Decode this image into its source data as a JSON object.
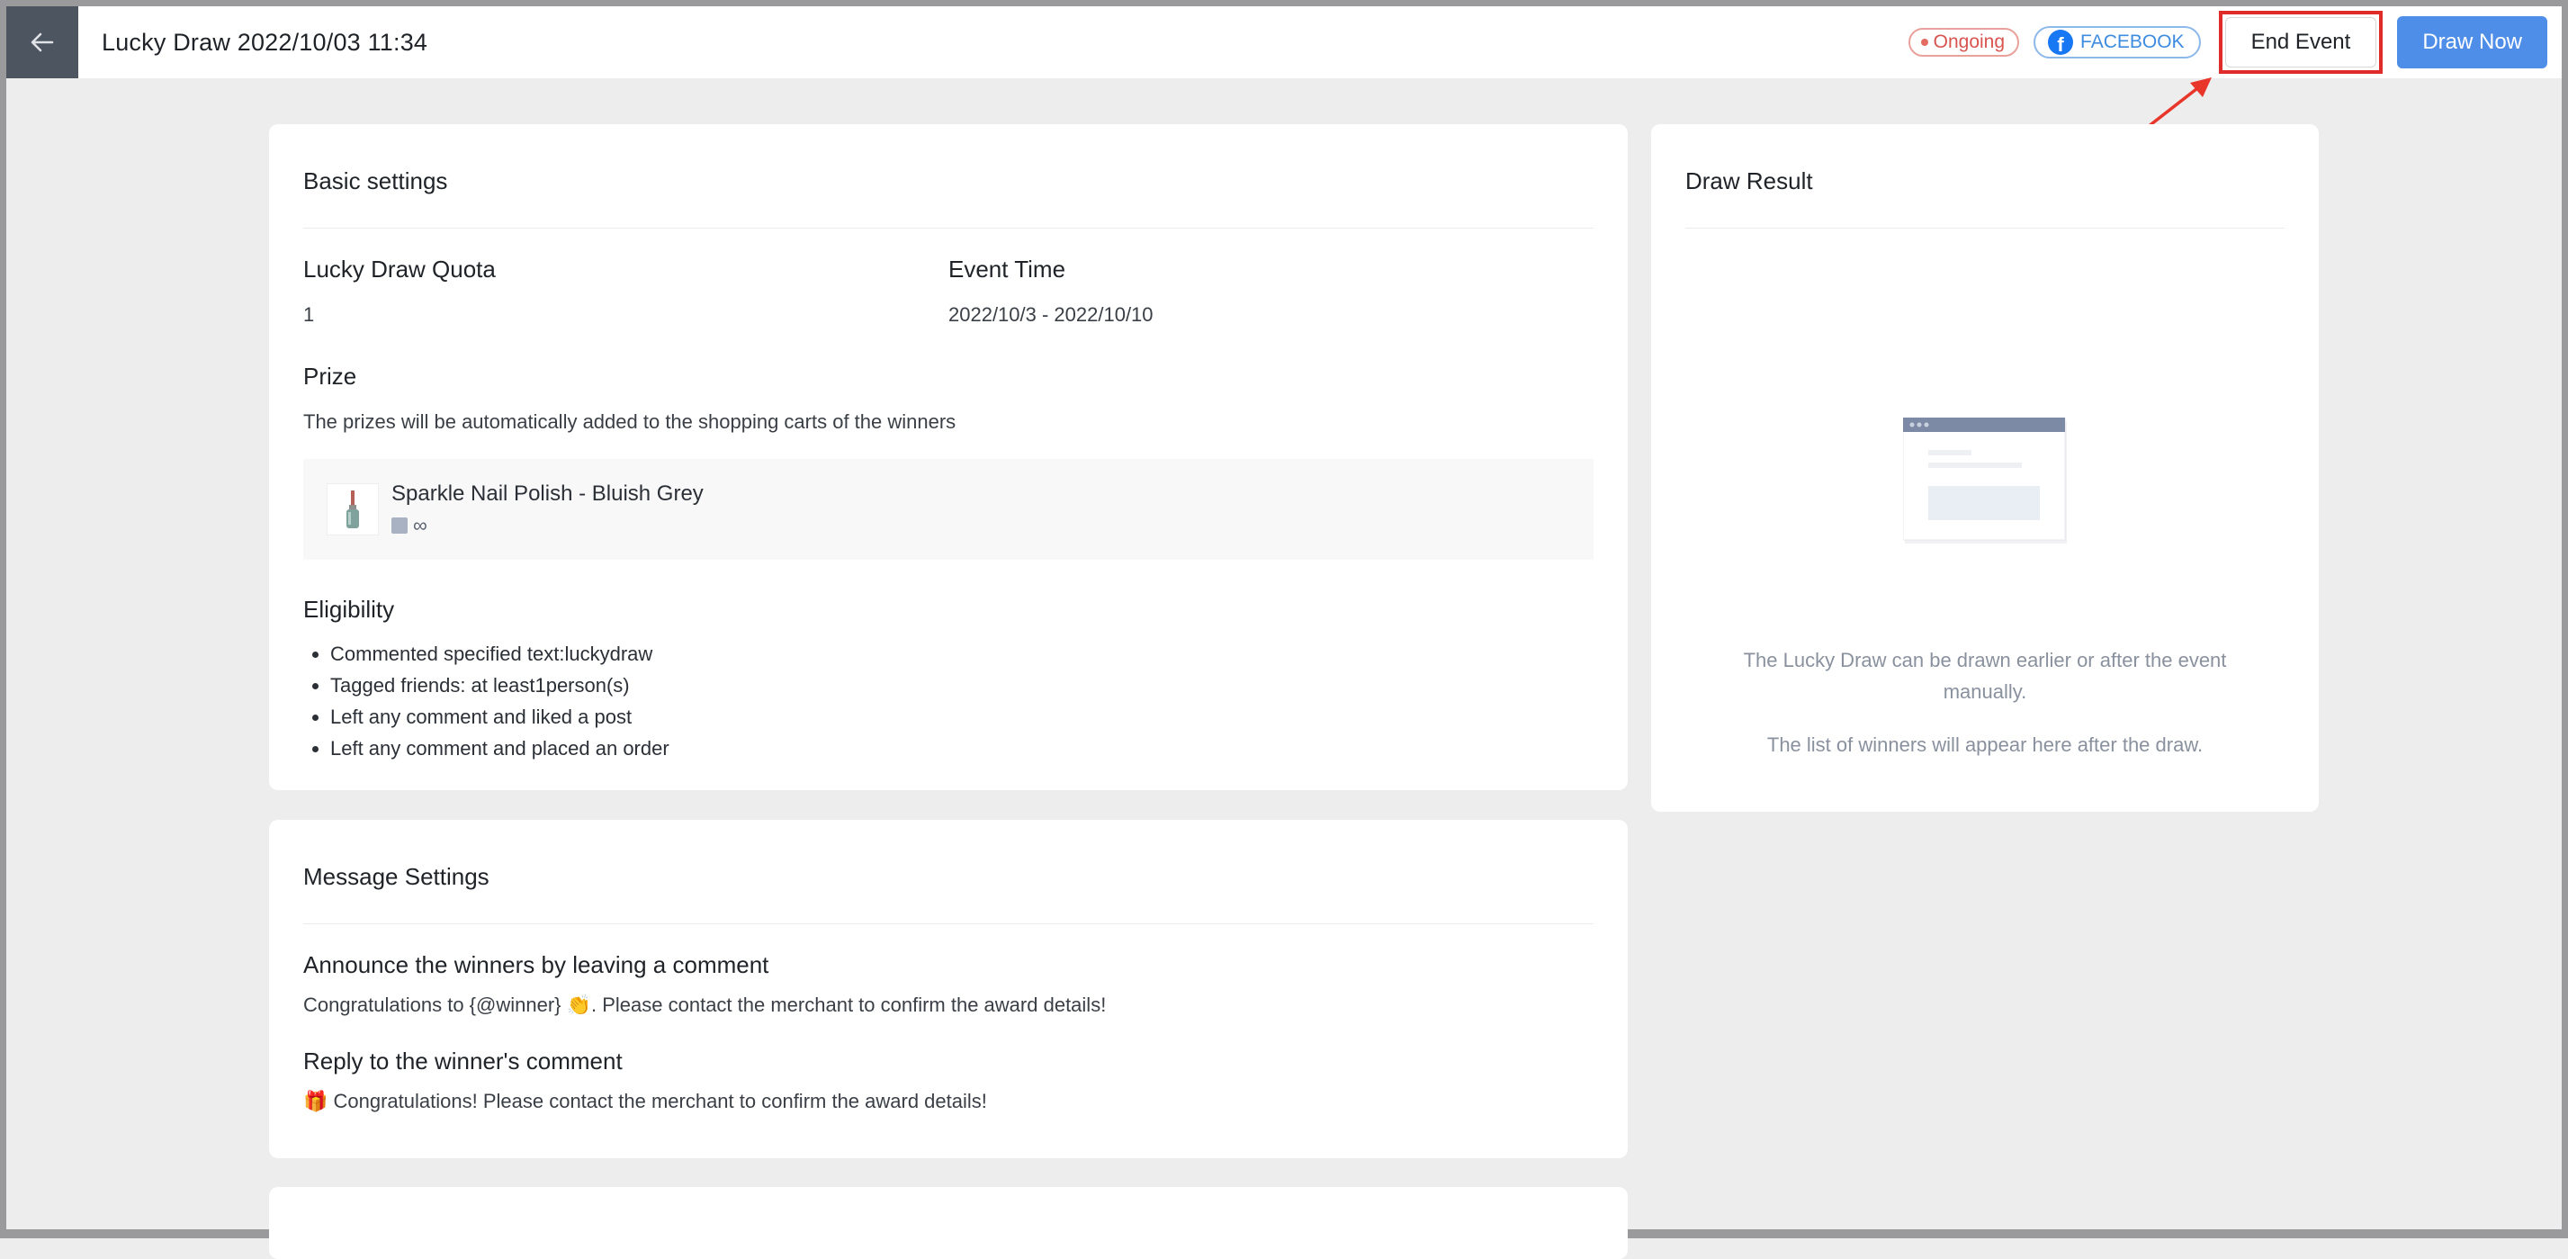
{
  "header": {
    "title": "Lucky Draw 2022/10/03 11:34",
    "status": "Ongoing",
    "platform": "FACEBOOK",
    "end_event_label": "End Event",
    "draw_now_label": "Draw Now",
    "colors": {
      "status": "#d9534f",
      "platform": "#3d8ce0",
      "primary": "#4f8ee8",
      "highlight": "#e02b2b"
    }
  },
  "basic_settings": {
    "title": "Basic settings",
    "quota_label": "Lucky Draw Quota",
    "quota_value": "1",
    "event_time_label": "Event Time",
    "event_time_value": "2022/10/3 - 2022/10/10",
    "prize_label": "Prize",
    "prize_note": "The prizes will be automatically added to the shopping carts of the winners",
    "prize": {
      "name": "Sparkle Nail Polish - Bluish Grey",
      "stock": "∞"
    },
    "eligibility_label": "Eligibility",
    "eligibility": [
      "Commented specified text:luckydraw",
      "Tagged friends: at least1person(s)",
      "Left any comment and liked a post",
      "Left any comment and placed an order"
    ]
  },
  "message_settings": {
    "title": "Message Settings",
    "announce_label": "Announce the winners by leaving a comment",
    "announce_text": "Congratulations to {@winner} 👏. Please contact the merchant to confirm the award details!",
    "reply_label": "Reply to the winner's comment",
    "reply_text": "🎁 Congratulations! Please contact the merchant to confirm the award details!"
  },
  "draw_result": {
    "title": "Draw Result",
    "empty_line1": "The Lucky Draw can be drawn earlier or after the event manually.",
    "empty_line2": "The list of winners will appear here after the draw."
  }
}
